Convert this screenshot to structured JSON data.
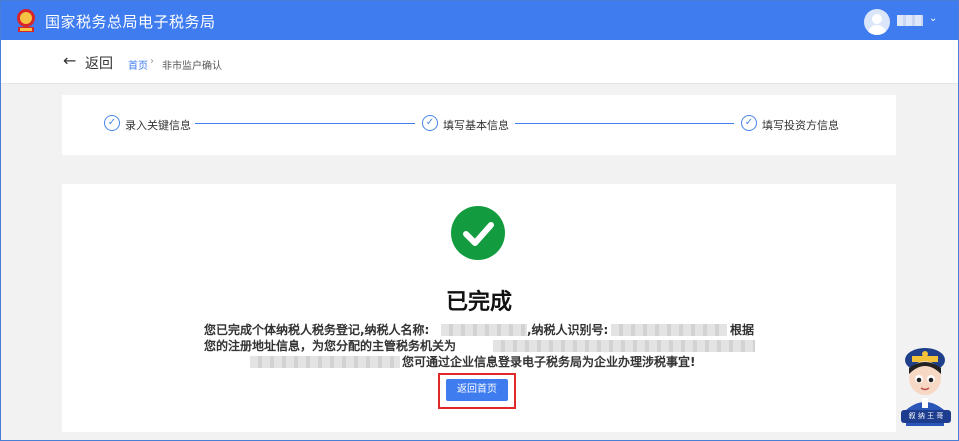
{
  "header": {
    "site_title": "国家税务总局电子税务局",
    "logo_icon": "tax-emblem-icon",
    "user_icon": "user-avatar-icon",
    "user_caret": "⌄"
  },
  "nav": {
    "back_arrow": "←",
    "back_label": "返回",
    "breadcrumb": [
      "首页",
      "非市监户确认"
    ],
    "breadcrumb_sep": "›"
  },
  "steps": [
    {
      "label": "录入关键信息",
      "icon": "check-circle-icon"
    },
    {
      "label": "填写基本信息",
      "icon": "check-circle-icon"
    },
    {
      "label": "填写投资方信息",
      "icon": "check-circle-icon"
    }
  ],
  "result": {
    "title": "已完成",
    "line1_a": "您已完成个体纳税人税务登记,纳税人名称:",
    "line1_b": ",纳税人识别号:",
    "line1_c": "根据",
    "line2_a": "您的注册地址信息，为您分配的主管税务机关为",
    "line3_a": "您可通过企业信息登录电子税务局为企业办理涉税事宜!",
    "button_label": "返回首页"
  },
  "mascot": {
    "badge_text": "叙 纳 王 哥"
  },
  "colors": {
    "brand_blue": "#3f7cf0",
    "success_green": "#139b3f",
    "highlight_red": "#e0292a"
  }
}
